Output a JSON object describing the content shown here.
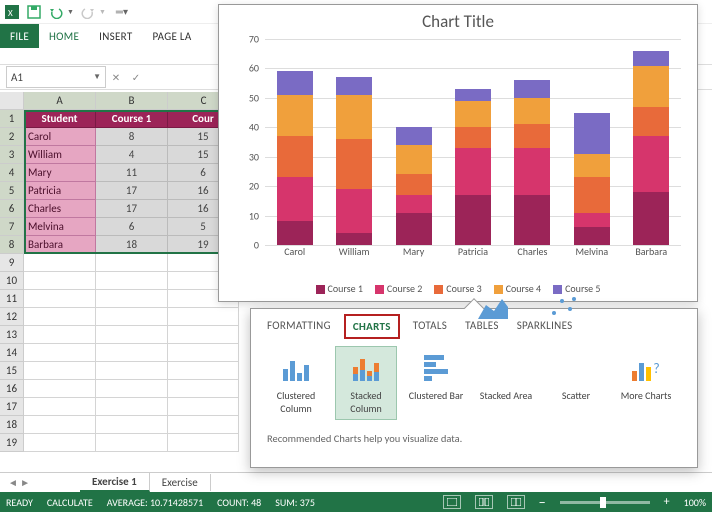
{
  "qat": {
    "save": "save-icon",
    "undo": "undo-icon",
    "redo": "redo-icon"
  },
  "ribbon": {
    "file": "FILE",
    "tabs": [
      "HOME",
      "INSERT",
      "PAGE LA"
    ]
  },
  "namebox": "A1",
  "fx_cancel": "✕",
  "fx_confirm": "✓",
  "table": {
    "headers": [
      "Student",
      "Course 1",
      "Cour"
    ],
    "rows": [
      {
        "name": "Carol",
        "c1": "8",
        "c2": "15"
      },
      {
        "name": "William",
        "c1": "4",
        "c2": "15"
      },
      {
        "name": "Mary",
        "c1": "11",
        "c2": "6"
      },
      {
        "name": "Patricia",
        "c1": "17",
        "c2": "16"
      },
      {
        "name": "Charles",
        "c1": "17",
        "c2": "16"
      },
      {
        "name": "Melvina",
        "c1": "6",
        "c2": "5"
      },
      {
        "name": "Barbara",
        "c1": "18",
        "c2": "19"
      }
    ]
  },
  "columns": [
    "A",
    "B",
    "C"
  ],
  "sheet_tabs": {
    "active": "Exercise 1",
    "next": "Exercise"
  },
  "statusbar": {
    "ready": "READY",
    "calculate": "CALCULATE",
    "average_label": "AVERAGE:",
    "average": "10.71428571",
    "count_label": "COUNT:",
    "count": "48",
    "sum_label": "SUM:",
    "sum": "375",
    "zoom": "100%"
  },
  "chart_data": {
    "type": "bar",
    "stacked": true,
    "title": "Chart Title",
    "ylim": [
      0,
      70
    ],
    "ytick": [
      0,
      10,
      20,
      30,
      40,
      50,
      60,
      70
    ],
    "categories": [
      "Carol",
      "William",
      "Mary",
      "Patricia",
      "Charles",
      "Melvina",
      "Barbara"
    ],
    "series": [
      {
        "name": "Course 1",
        "color": "#9c2458",
        "values": [
          8,
          4,
          11,
          17,
          17,
          6,
          18
        ]
      },
      {
        "name": "Course 2",
        "color": "#d6356c",
        "values": [
          15,
          15,
          6,
          16,
          16,
          5,
          19
        ]
      },
      {
        "name": "Course 3",
        "color": "#e86a3a",
        "values": [
          14,
          17,
          7,
          7,
          8,
          12,
          10
        ]
      },
      {
        "name": "Course 4",
        "color": "#f0a03c",
        "values": [
          14,
          15,
          10,
          9,
          9,
          8,
          14
        ]
      },
      {
        "name": "Course 5",
        "color": "#7a6bc4",
        "values": [
          8,
          6,
          6,
          4,
          6,
          14,
          5
        ]
      }
    ]
  },
  "qa": {
    "tabs": [
      "FORMATTING",
      "CHARTS",
      "TOTALS",
      "TABLES",
      "SPARKLINES"
    ],
    "active_tab": "CHARTS",
    "items": [
      "Clustered Column",
      "Stacked Column",
      "Clustered Bar",
      "Stacked Area",
      "Scatter",
      "More Charts"
    ],
    "selected_item": 1,
    "footer": "Recommended Charts help you visualize data."
  }
}
